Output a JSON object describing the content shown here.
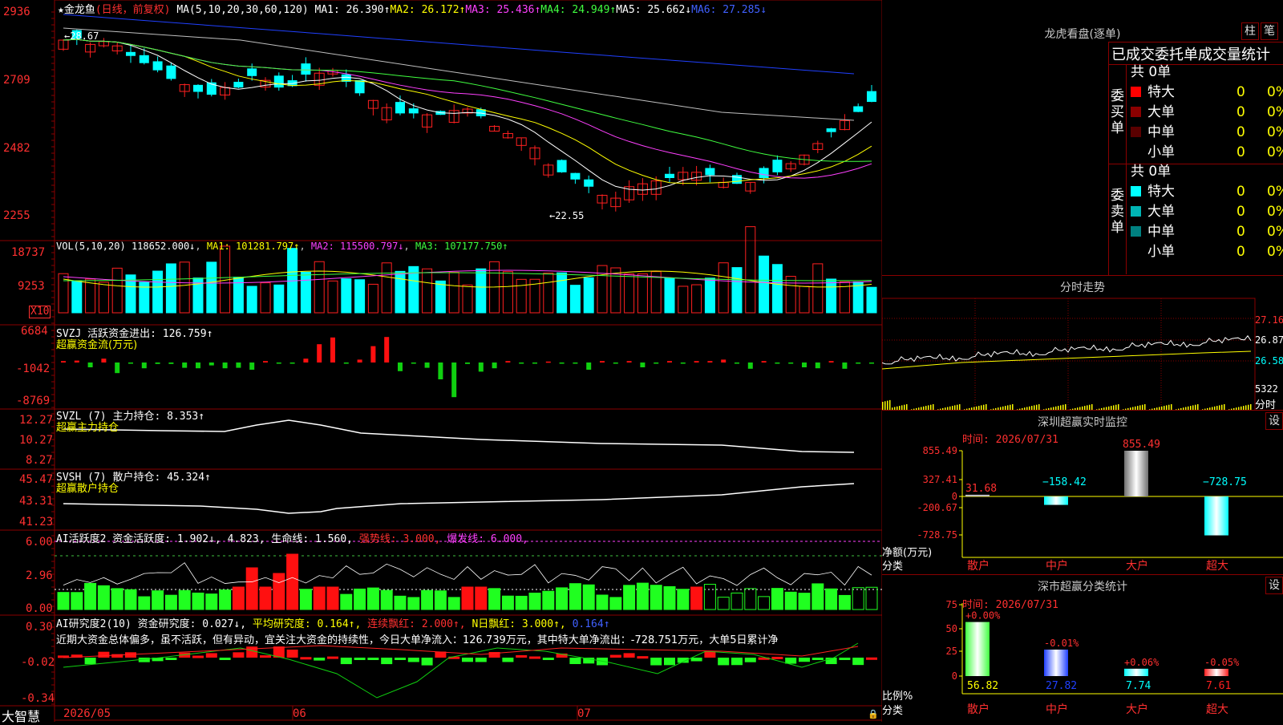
{
  "app": {
    "brand": "大智慧"
  },
  "stock": {
    "name": "金龙鱼",
    "period": "(日线，前复权)",
    "star": "★"
  },
  "ma_legend": {
    "params": "MA(5,10,20,30,60,120)",
    "ma1": "MA1: 26.390↑",
    "ma2": "MA2: 26.172↑",
    "ma3": "MA3: 25.436↑",
    "ma4": "MA4: 24.949↑",
    "ma5": "MA5: 25.662↓",
    "ma6": "MA6: 27.285↓"
  },
  "price_axis": [
    "2936",
    "2709",
    "2482",
    "2255"
  ],
  "price_marks": {
    "high": "←28.67",
    "low": "←22.55"
  },
  "vol": {
    "params": "VOL(5,10,20)",
    "value": "118652.000↓",
    "ma1": "MA1: 101281.797↑",
    "ma2": "MA2: 115500.797↓",
    "ma3": "MA3: 107177.750↑",
    "axis": [
      "18737",
      "9253"
    ],
    "unit": "X10"
  },
  "svzj": {
    "title": "SVZJ  活跃资金进出: 126.759↑",
    "subtitle": "超赢资金流(万元)",
    "axis": [
      "6684",
      "-1042",
      "-8769"
    ]
  },
  "svzl": {
    "title": "SVZL (7) 主力持仓: 8.353↑",
    "subtitle": "超赢主力持仓",
    "axis": [
      "12.27",
      "10.27",
      "8.27"
    ]
  },
  "svsh": {
    "title": "SVSH (7) 散户持仓: 45.324↑",
    "subtitle": "超赢散户持仓",
    "axis": [
      "45.47",
      "43.31",
      "41.23"
    ]
  },
  "ai_active": {
    "prefix": "AI活跃度2 资金活跃度: 1.902↓, 4.823, 生命线: 1.560,",
    "strong": "强势线: 3.000,",
    "burst": "爆发线: 6.000,",
    "axis": [
      "6.00",
      "2.96",
      "0.00"
    ]
  },
  "ai_research": {
    "prefix": "AI研究度2(10) 资金研究度: 0.027↓,",
    "avg": "平均研究度: 0.164↑,",
    "cont": "连续飘红: 2.000↑,",
    "nday": "N日飘红: 3.000↑,",
    "last": "0.164↑",
    "text": "近期大资金总体偏多，虽不活跃，但有异动，宜关注大资金的持续性，今日大单净流入：126.739万元，其中特大单净流出：-728.751万元，大单5日累计净",
    "axis": [
      "0.30",
      "-0.02",
      "-0.34"
    ]
  },
  "date_axis": [
    "2026/05",
    "06",
    "07"
  ],
  "lhb": {
    "title": "龙虎看盘(逐单)",
    "btn1": "柱",
    "btn2": "笔",
    "heading": "已成交委托单成交量统计",
    "buy_label": "委买单",
    "sell_label": "委卖单",
    "buy_total": "共 0单",
    "sell_total": "共 0单",
    "buy": [
      {
        "name": "特大",
        "count": "0",
        "pct": "0%",
        "color": "#ff0000"
      },
      {
        "name": "大单",
        "count": "0",
        "pct": "0%",
        "color": "#8b0000"
      },
      {
        "name": "中单",
        "count": "0",
        "pct": "0%",
        "color": "#5a0000"
      },
      {
        "name": "小单",
        "count": "0",
        "pct": "0%",
        "color": "#000000"
      }
    ],
    "sell": [
      {
        "name": "特大",
        "count": "0",
        "pct": "0%",
        "color": "#00ffff"
      },
      {
        "name": "大单",
        "count": "0",
        "pct": "0%",
        "color": "#00b4b4"
      },
      {
        "name": "中单",
        "count": "0",
        "pct": "0%",
        "color": "#008080"
      },
      {
        "name": "小单",
        "count": "0",
        "pct": "0%",
        "color": "#000000"
      }
    ]
  },
  "intraday": {
    "title": "分时走势",
    "axis": [
      "27.16",
      "26.87",
      "26.58"
    ],
    "vol_label": "5322",
    "unit": "分时"
  },
  "sz_monitor": {
    "title": "深圳超赢实时监控",
    "btn": "设",
    "time": "时间: 2026/07/31",
    "axis": [
      "855.49",
      "327.41",
      "0",
      "-200.67",
      "-728.75"
    ],
    "ylabel": "净额(万元)",
    "xlabel": "分类",
    "bars": [
      {
        "cat": "散户",
        "value": 31.68,
        "label": "31.68"
      },
      {
        "cat": "中户",
        "value": -158.42,
        "label": "−158.42"
      },
      {
        "cat": "大户",
        "value": 855.49,
        "label": "855.49"
      },
      {
        "cat": "超大",
        "value": -728.75,
        "label": "−728.75"
      }
    ]
  },
  "sz_class": {
    "title": "深市超赢分类统计",
    "btn": "设",
    "time": "时间: 2026/07/31",
    "axis": [
      "75",
      "50",
      "25",
      "0"
    ],
    "ylabel": "比例%",
    "xlabel": "分类",
    "bars": [
      {
        "cat": "散户",
        "value": 56.82,
        "change": "+0.00%",
        "label": "56.82",
        "color": "#40ff40"
      },
      {
        "cat": "中户",
        "value": 27.82,
        "change": "-0.01%",
        "label": "27.82",
        "color": "#2040ff"
      },
      {
        "cat": "大户",
        "value": 7.74,
        "change": "+0.06%",
        "label": "7.74",
        "color": "#00ffff"
      },
      {
        "cat": "超大",
        "value": 7.61,
        "change": "-0.05%",
        "label": "7.61",
        "color": "#ff2020"
      }
    ]
  },
  "colors": {
    "up": "#ff2020",
    "down": "#00ffff",
    "grid": "#8a0000",
    "axis_text": "#ff3030"
  }
}
